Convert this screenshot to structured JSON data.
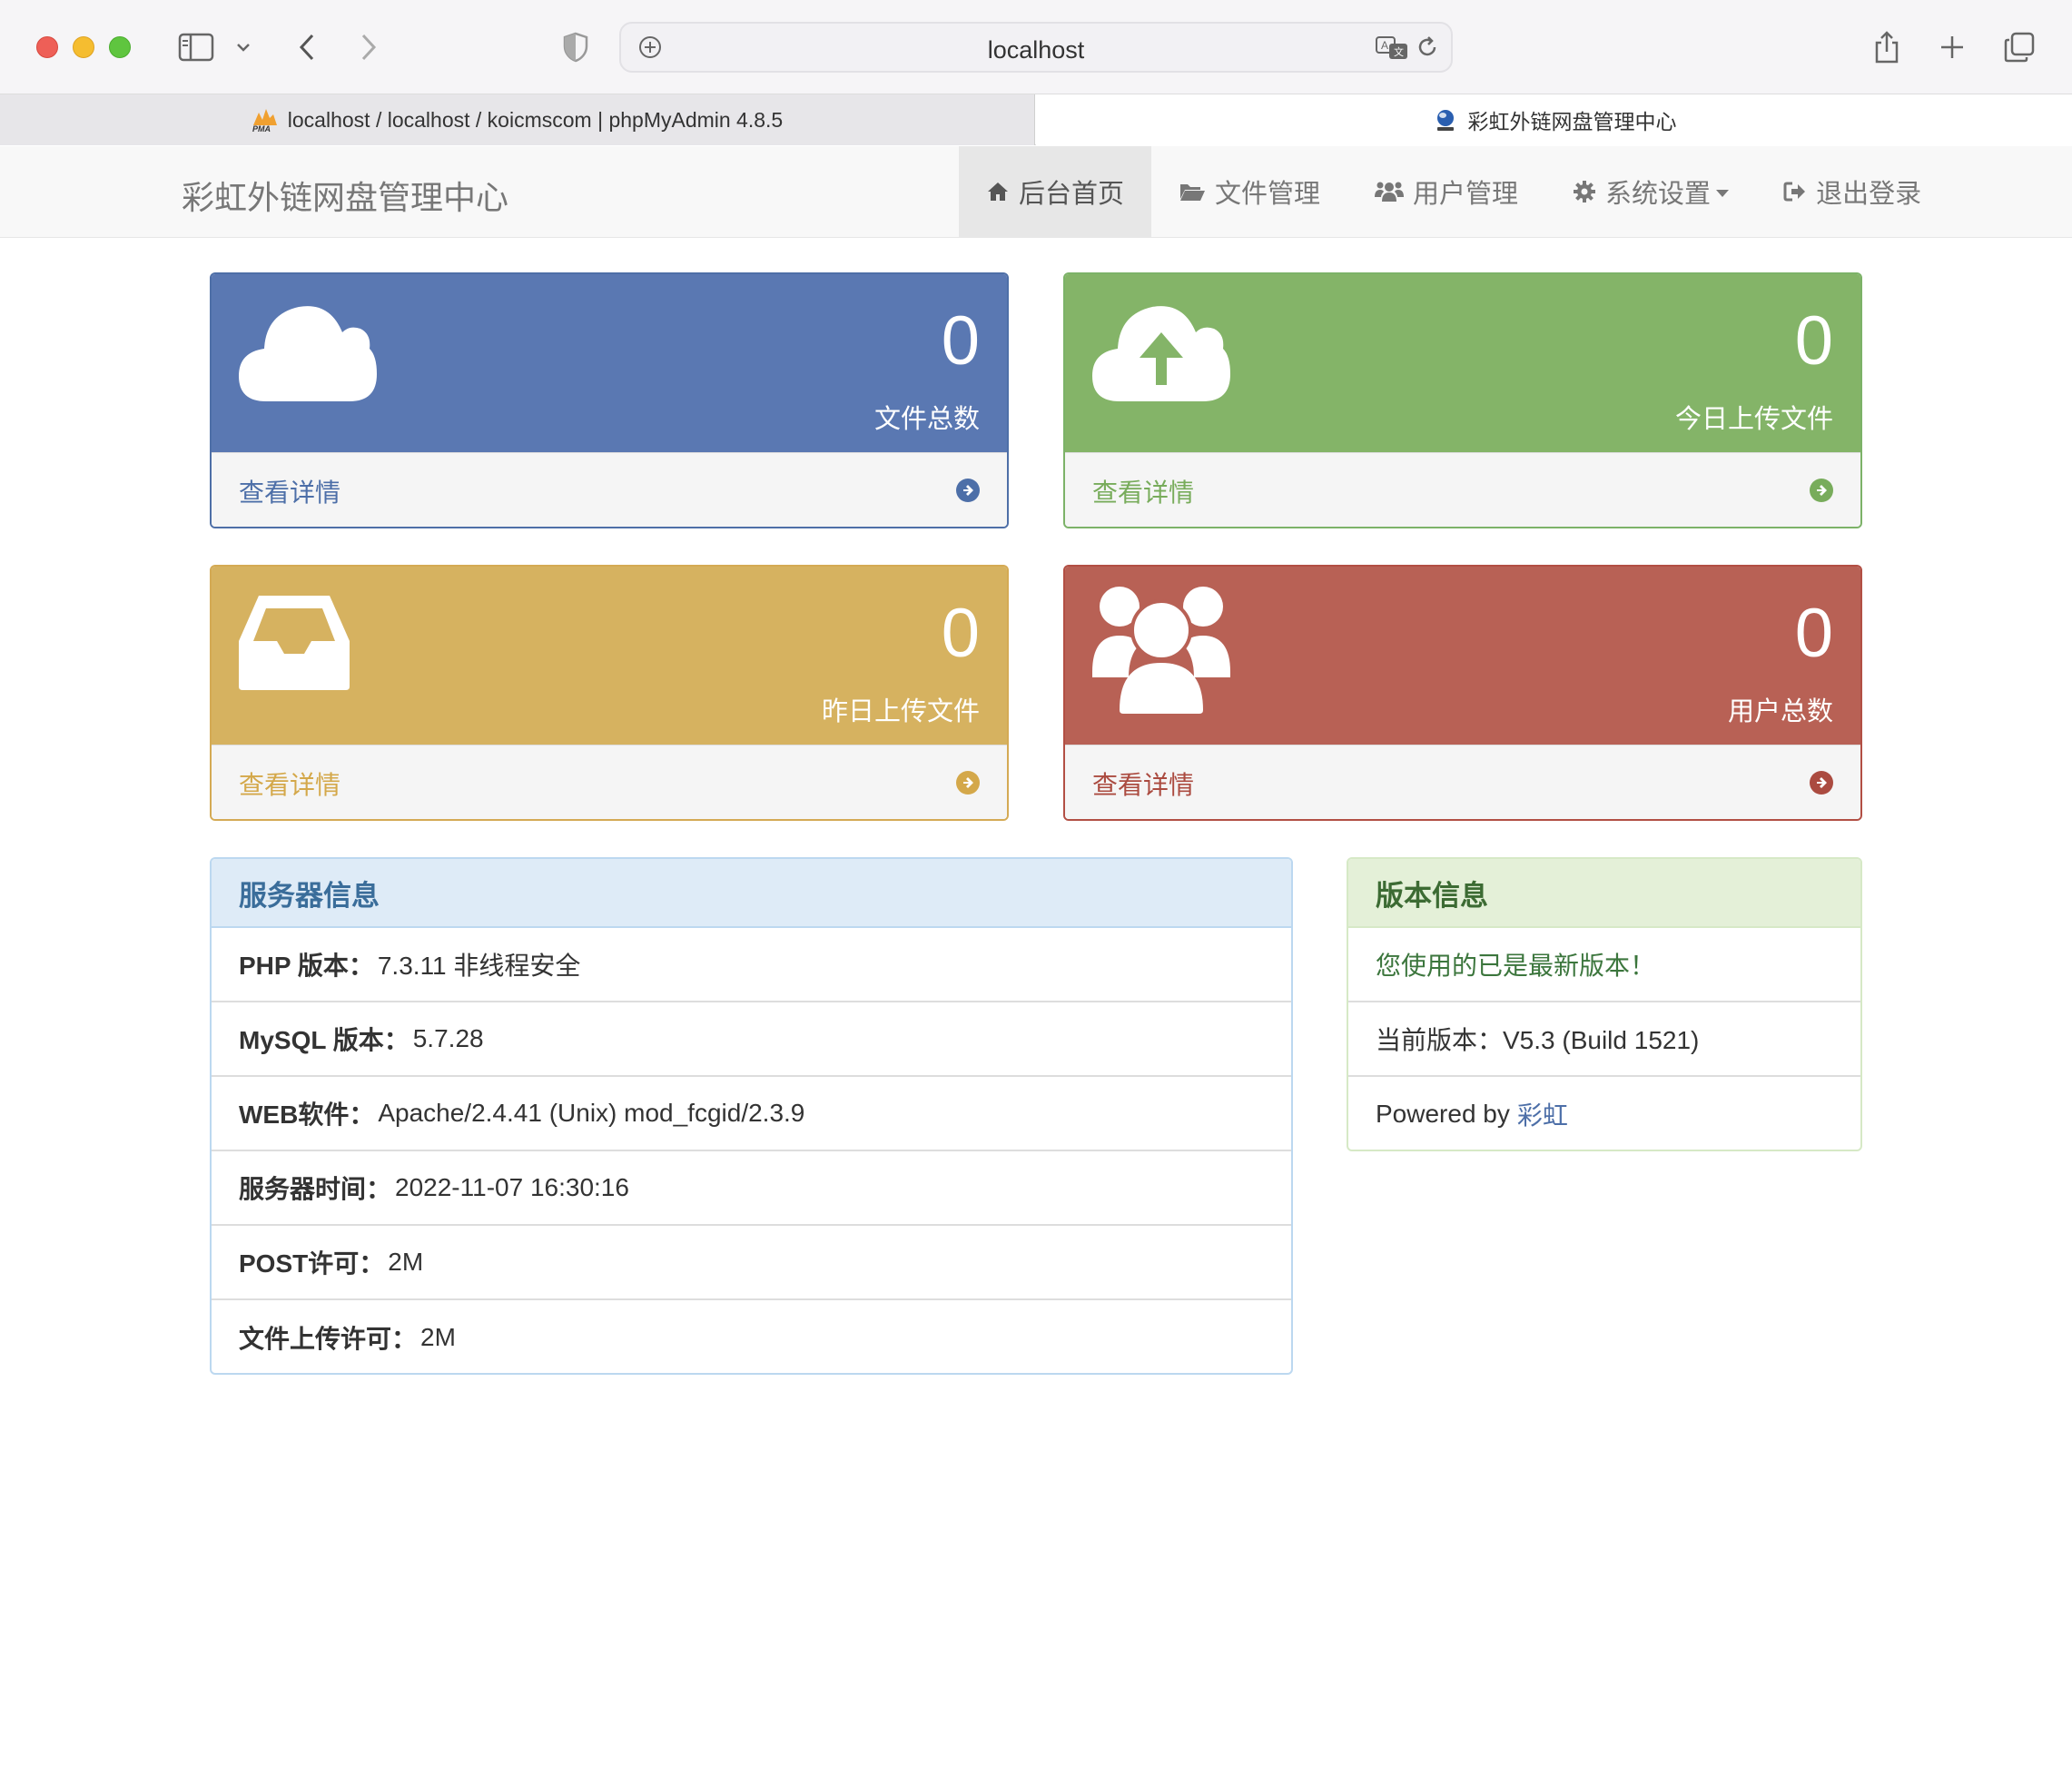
{
  "browser": {
    "url": "localhost",
    "tabs": [
      {
        "label": "localhost / localhost / koicmscom | phpMyAdmin 4.8.5",
        "favicon": "pma-icon"
      },
      {
        "label": "彩虹外链网盘管理中心",
        "favicon": "globe-icon"
      }
    ]
  },
  "app": {
    "brand": "彩虹外链网盘管理中心",
    "nav": [
      {
        "label": "后台首页",
        "icon": "home-icon",
        "active": true
      },
      {
        "label": "文件管理",
        "icon": "folder-open-icon"
      },
      {
        "label": "用户管理",
        "icon": "users-icon"
      },
      {
        "label": "系统设置",
        "icon": "gear-icon",
        "dropdown": true
      },
      {
        "label": "退出登录",
        "icon": "logout-icon"
      }
    ]
  },
  "stats": [
    {
      "value": "0",
      "label": "文件总数",
      "link": "查看详情",
      "icon": "cloud-icon",
      "color": "#5a78b2"
    },
    {
      "value": "0",
      "label": "今日上传文件",
      "link": "查看详情",
      "icon": "cloud-upload-icon",
      "color": "#84b468"
    },
    {
      "value": "0",
      "label": "昨日上传文件",
      "link": "查看详情",
      "icon": "inbox-icon",
      "color": "#d6b260"
    },
    {
      "value": "0",
      "label": "用户总数",
      "link": "查看详情",
      "icon": "users-icon",
      "color": "#b86155"
    }
  ],
  "server_info": {
    "title": "服务器信息",
    "rows": [
      {
        "label": "PHP 版本：",
        "value": "7.3.11 非线程安全"
      },
      {
        "label": "MySQL 版本：",
        "value": "5.7.28"
      },
      {
        "label": "WEB软件：",
        "value": "Apache/2.4.41 (Unix) mod_fcgid/2.3.9"
      },
      {
        "label": "服务器时间：",
        "value": "2022-11-07 16:30:16"
      },
      {
        "label": "POST许可：",
        "value": "2M"
      },
      {
        "label": "文件上传许可：",
        "value": "2M"
      }
    ]
  },
  "version_info": {
    "title": "版本信息",
    "latest_msg": "您使用的已是最新版本！",
    "current": "当前版本：V5.3 (Build 1521)",
    "powered_prefix": "Powered by",
    "powered_link": "彩虹"
  }
}
